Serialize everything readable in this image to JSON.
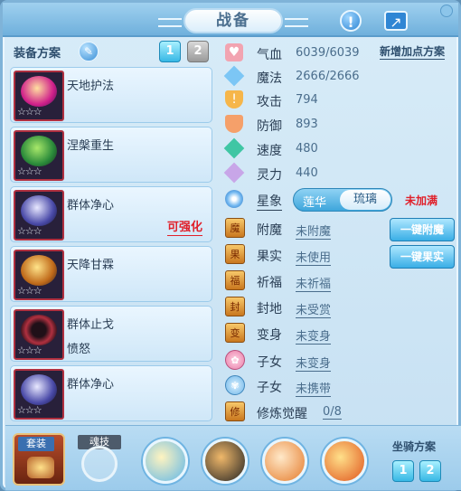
{
  "window": {
    "title": "战备"
  },
  "top_icons": [
    "alert-icon",
    "share-icon"
  ],
  "equipment_plan": {
    "label": "装备方案",
    "tabs": [
      "1",
      "2"
    ],
    "active_tab": "1"
  },
  "equipment": [
    {
      "name": "天地护法",
      "sub": "",
      "tag": "",
      "stars": "☆☆☆"
    },
    {
      "name": "涅槃重生",
      "sub": "",
      "tag": "",
      "stars": "☆☆☆"
    },
    {
      "name": "群体净心",
      "sub": "",
      "tag": "可强化",
      "stars": "☆☆☆"
    },
    {
      "name": "天降甘霖",
      "sub": "",
      "tag": "",
      "stars": "☆☆☆"
    },
    {
      "name": "群体止戈",
      "sub": "愤怒",
      "tag": "",
      "stars": "☆☆☆"
    },
    {
      "name": "群体净心",
      "sub": "",
      "tag": "",
      "stars": "☆☆☆"
    }
  ],
  "new_plan_link": "新增加点方案",
  "stats": [
    {
      "label": "气血",
      "value": "6039/6039",
      "icon": "heart-icon"
    },
    {
      "label": "魔法",
      "value": "2666/2666",
      "icon": "mana-icon"
    },
    {
      "label": "攻击",
      "value": "794",
      "icon": "attack-icon"
    },
    {
      "label": "防御",
      "value": "893",
      "icon": "defense-icon"
    },
    {
      "label": "速度",
      "value": "480",
      "icon": "speed-icon"
    },
    {
      "label": "灵力",
      "value": "440",
      "icon": "spirit-icon"
    }
  ],
  "xingxiang": {
    "label": "星象",
    "options": [
      "莲华",
      "琉璃"
    ],
    "selected": "琉璃",
    "note": "未加满"
  },
  "attachments": [
    {
      "label": "附魔",
      "value": "未附魔"
    },
    {
      "label": "果实",
      "value": "未使用"
    },
    {
      "label": "祈福",
      "value": "未祈福"
    },
    {
      "label": "封地",
      "value": "未受赏"
    },
    {
      "label": "变身",
      "value": "未变身"
    },
    {
      "label": "子女",
      "value": "未变身"
    },
    {
      "label": "子女",
      "value": "未携带"
    },
    {
      "label": "修炼觉醒",
      "value": "0/8"
    }
  ],
  "side_buttons": [
    "一键附魔",
    "一键果实"
  ],
  "bottom": {
    "suit_tag": "套装",
    "skill_tag": "魂技",
    "mount_label": "坐骑方案",
    "mount_tabs": [
      "1",
      "2"
    ]
  }
}
